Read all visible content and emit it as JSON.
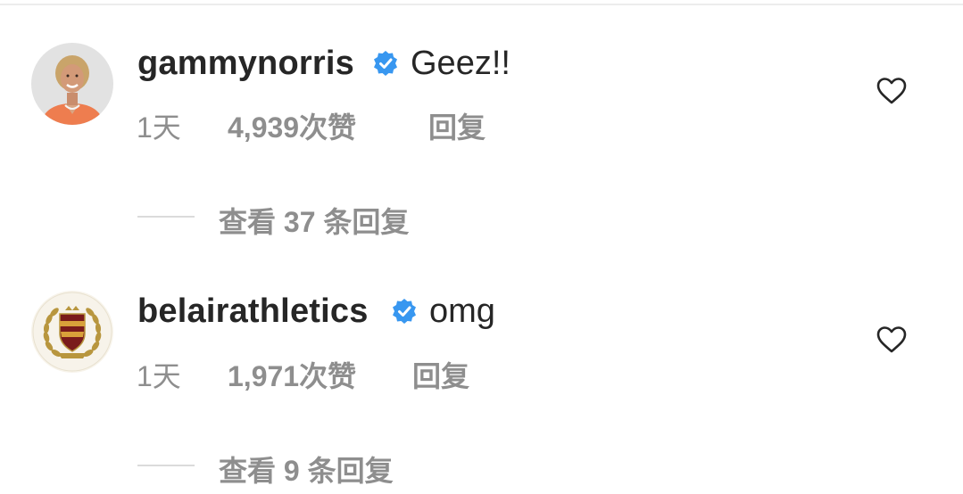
{
  "comments": [
    {
      "avatar_icon": "woman-portrait-avatar",
      "username": "gammynorris",
      "verified_icon": "verified-badge-icon",
      "text": "Geez!!",
      "age": "1天",
      "likes": "4,939次赞",
      "reply_label": "回复",
      "view_replies": "查看 37 条回复"
    },
    {
      "avatar_icon": "crest-shield-laurel-avatar",
      "username": "belairathletics",
      "verified_icon": "verified-badge-icon",
      "text": "omg",
      "age": "1天",
      "likes": "1,971次赞",
      "reply_label": "回复",
      "view_replies": "查看 9 条回复"
    }
  ],
  "colors": {
    "text_primary": "#262626",
    "text_secondary": "#8e8e8e",
    "verified_blue": "#3897f0",
    "divider": "#dbdbdb"
  },
  "icons": {
    "like": "heart-outline-icon"
  }
}
